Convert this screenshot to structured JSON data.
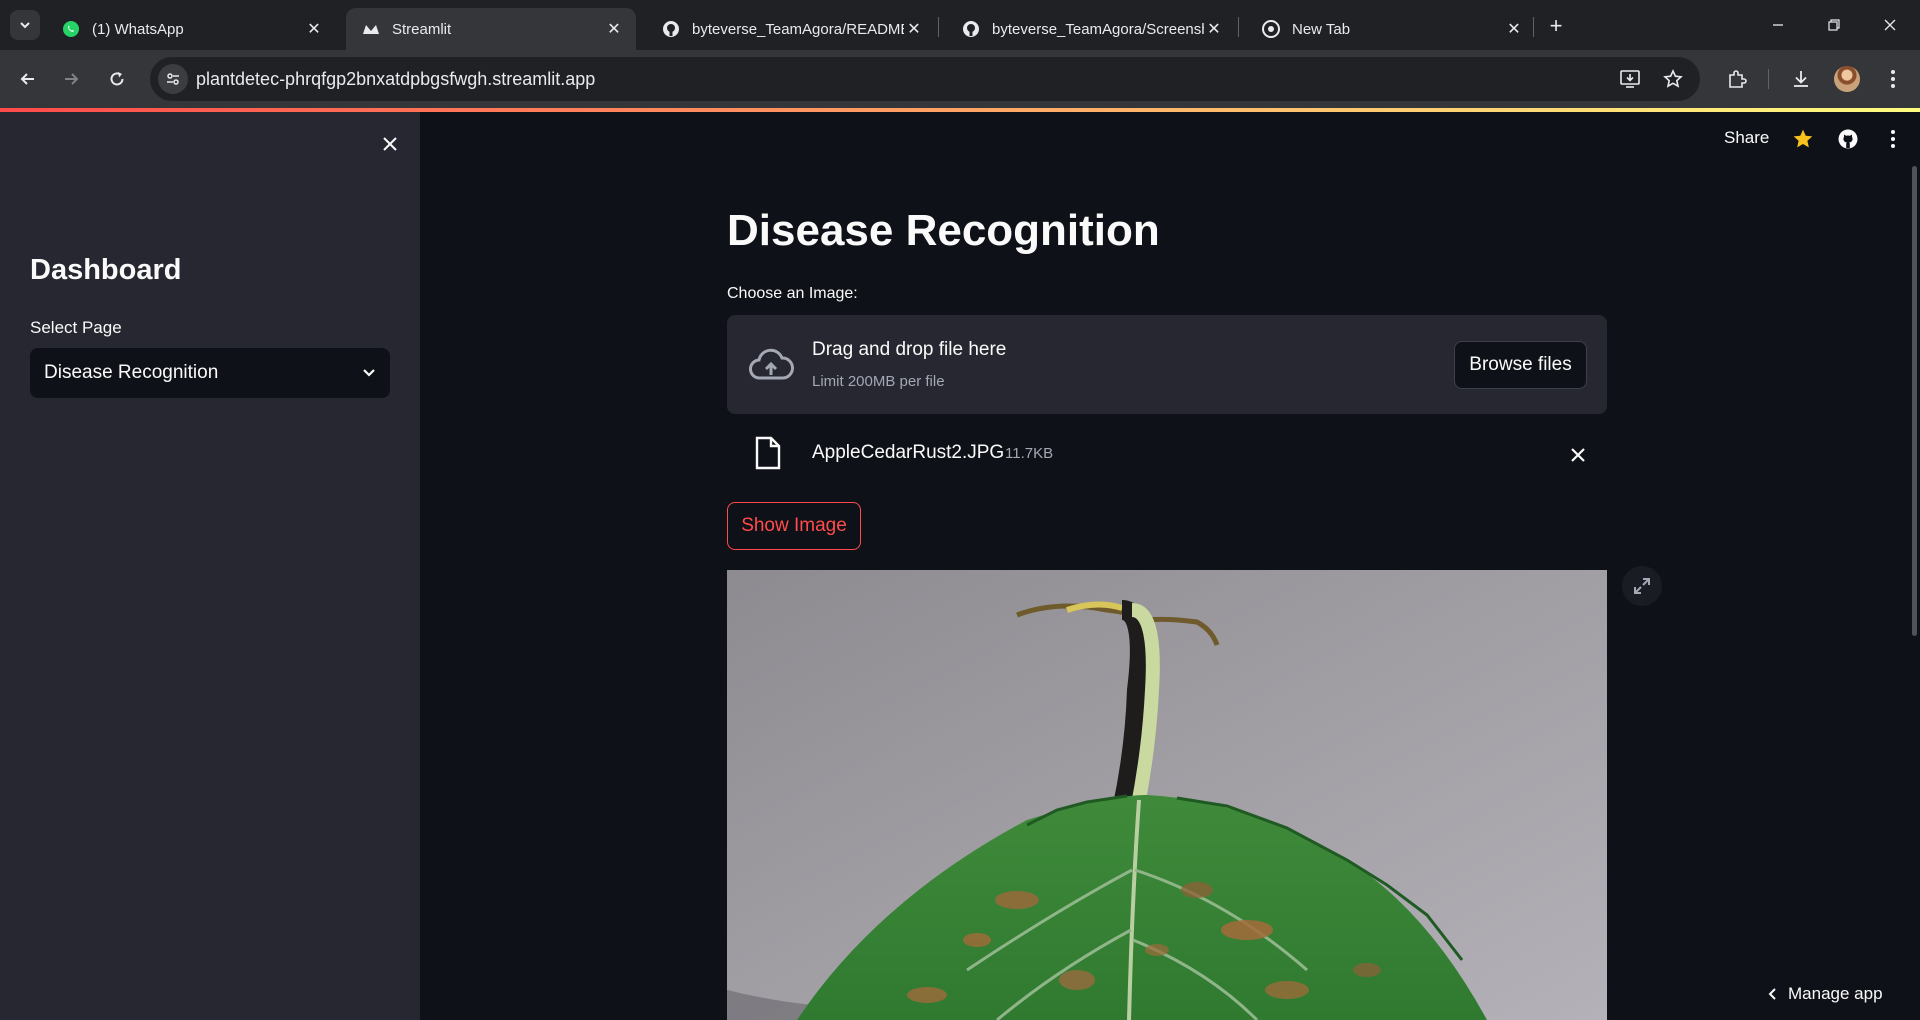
{
  "browser": {
    "tabs": [
      {
        "title": "(1) WhatsApp",
        "icon": "whatsapp-icon"
      },
      {
        "title": "Streamlit",
        "icon": "streamlit-icon"
      },
      {
        "title": "byteverse_TeamAgora/README",
        "icon": "github-icon"
      },
      {
        "title": "byteverse_TeamAgora/Screensh",
        "icon": "github-icon"
      },
      {
        "title": "New Tab",
        "icon": "chrome-icon"
      }
    ],
    "url": "plantdetec-phrqfgp2bnxatdpbgsfwgh.streamlit.app"
  },
  "sidebar": {
    "title": "Dashboard",
    "select_label": "Select Page",
    "select_value": "Disease Recognition"
  },
  "header": {
    "share_label": "Share"
  },
  "main": {
    "title": "Disease Recognition",
    "uploader": {
      "label": "Choose an Image:",
      "drop_text": "Drag and drop file here",
      "limit_text": "Limit 200MB per file",
      "browse_label": "Browse files"
    },
    "file": {
      "name": "AppleCedarRust2.JPG",
      "size": "11.7KB"
    },
    "show_button_label": "Show Image"
  },
  "footer": {
    "manage_label": "Manage app"
  },
  "colors": {
    "accent": "#ff4b4b",
    "background": "#0e1117",
    "sidebar": "#262730"
  }
}
